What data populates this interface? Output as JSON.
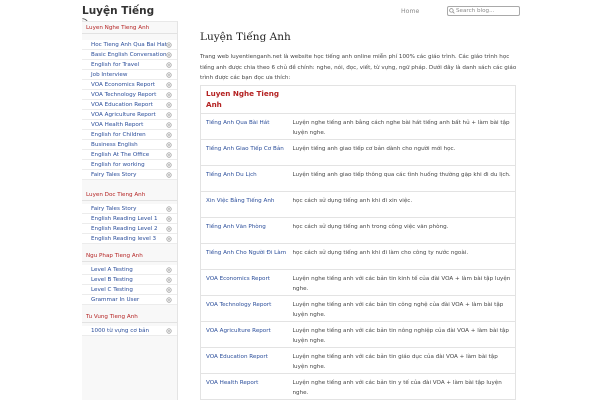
{
  "header": {
    "site_title": "Luyện Tiếng",
    "nav_home": "Home",
    "search_placeholder": "Search blog..."
  },
  "sidebar": {
    "sections": [
      {
        "heading": "Luyen Nghe Tieng Anh",
        "items": [
          "Hoc Tieng Anh Qua Bai Hat",
          "Basic English Conversation",
          "English for Travel",
          "Job Interview",
          "VOA Economics Report",
          "VOA Technology Report",
          "VOA Education Report",
          "VOA Agriculture Report",
          "VOA Health Report",
          "English for Children",
          "Business English",
          "English At The Office",
          "English for working",
          "Fairy Tales Story"
        ]
      },
      {
        "heading": "Luyen Doc Tieng Anh",
        "items": [
          "Fairy Tales Story",
          "English Reading Level 1",
          "English Reading Level 2",
          "English Reading level 3"
        ]
      },
      {
        "heading": "Ngu Phap Tieng Anh",
        "items": [
          "Level A Testing",
          "Level B Testing",
          "Level C Testing",
          "Grammar In User"
        ]
      },
      {
        "heading": "Tu Vung Tieng Anh",
        "items": [
          "1000 từ vựng cơ bản"
        ]
      }
    ]
  },
  "main": {
    "title": "Luyện Tiếng Anh",
    "intro": "Trang web luyentienganh.net là website học tiếng anh online miễn phí 100% các giáo trình. Các giáo trình học tiếng anh được chia theo 6 chủ đề chính: nghe, nói, đọc, viết, từ vựng, ngữ pháp. Dưới đây là danh sách các giáo trình được các bạn đọc ưa thích:",
    "table_heading_line1": "Luyen Nghe Tieng",
    "table_heading_line2": "Anh",
    "courses": [
      {
        "name": "Tiếng Anh Qua Bài Hát",
        "desc": "Luyện nghe tiếng anh bằng cách nghe bài hát tiếng anh bất hủ + làm bài tập luyện nghe."
      },
      {
        "name": "Tiếng Anh Giao Tiếp Cơ Bản",
        "desc": "Luyện tiếng anh giao tiếp cơ bản dành cho người mới học."
      },
      {
        "name": "Tiếng Anh Du Lịch",
        "desc": "Luyện tiếng anh giao tiếp thông qua các tình huống thường gặp khi đi du lịch."
      },
      {
        "name": "Xin Việc Bằng Tiếng Anh",
        "desc": "học cách sử dụng tiếng anh khi đi xin việc."
      },
      {
        "name": "Tiếng Anh Văn Phòng",
        "desc": "học cách sử dụng tiếng anh trong công việc văn phòng."
      },
      {
        "name": "Tiếng Anh Cho Người Đi Làm",
        "desc": "học cách sử dụng tiếng anh khi đi làm cho công ty nước ngoài."
      },
      {
        "name": "VOA Economics Report",
        "desc": "Luyện nghe tiếng anh với các bản tin kinh tế của đài VOA + làm bài tập luyện nghe."
      },
      {
        "name": "VOA Technology Report",
        "desc": "Luyện nghe tiếng anh với các bản tin công nghệ của đài VOA + làm bài tập luyện nghe."
      },
      {
        "name": "VOA Agriculture Report",
        "desc": "Luyện nghe tiếng anh với các bản tin nông nghiệp của đài VOA + làm bài tập luyện nghe."
      },
      {
        "name": "VOA Education Report",
        "desc": "Luyện nghe tiếng anh với các bản tin giáo dục của đài VOA + làm bài tập luyện nghe."
      },
      {
        "name": "VOA Health Report",
        "desc": "Luyện nghe tiếng anh với các bản tin y tế của đài VOA + làm bài tập luyện nghe."
      }
    ]
  },
  "colors": {
    "link": "#2a4d9a",
    "heading_red": "#b42222",
    "sidebar_bg": "#f8f8f8"
  },
  "icons": {
    "rss": "rss-icon",
    "search": "search-icon",
    "bullet": "circle-bullet-icon"
  }
}
